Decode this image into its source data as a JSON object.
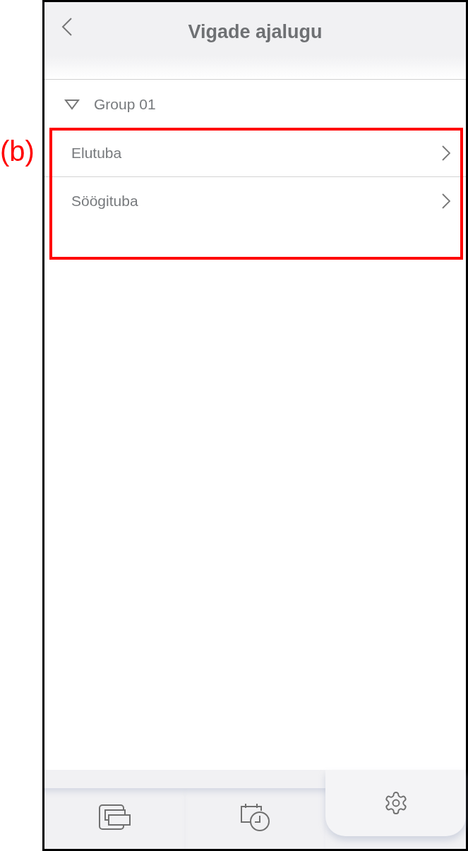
{
  "annotation": {
    "label": "(b)"
  },
  "header": {
    "title": "Vigade ajalugu"
  },
  "group": {
    "label": "Group 01",
    "expanded": true
  },
  "rooms": [
    {
      "label": "Elutuba"
    },
    {
      "label": "Söögituba"
    }
  ],
  "tabs": [
    {
      "kind": "devices",
      "selected": false
    },
    {
      "kind": "history",
      "selected": false
    },
    {
      "kind": "settings",
      "selected": true
    }
  ]
}
